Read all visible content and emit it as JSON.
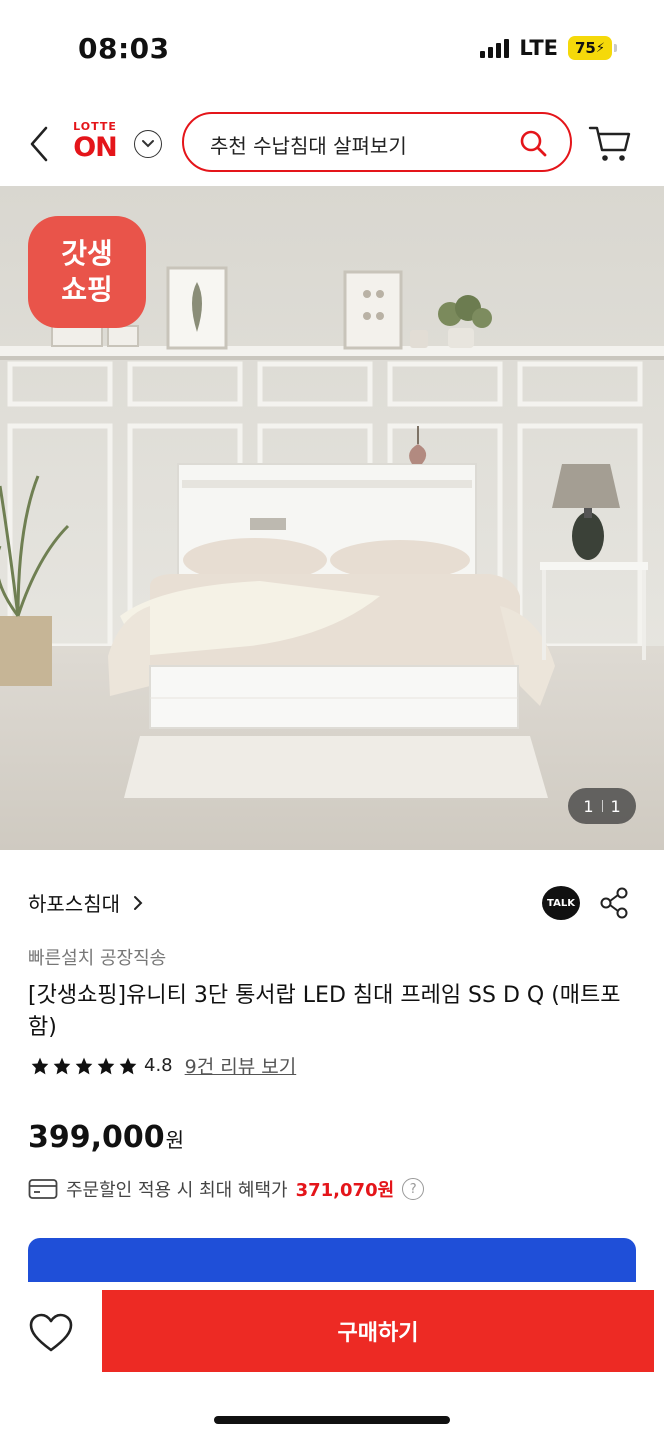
{
  "status": {
    "time": "08:03",
    "network": "LTE",
    "battery": "75"
  },
  "header": {
    "logo_top": "LOTTE",
    "logo_main": "ON",
    "search_text": "추천 수납침대 살펴보기"
  },
  "hero": {
    "badge_line1": "갓생",
    "badge_line2": "쇼핑",
    "page_current": "1",
    "page_total": "1"
  },
  "product": {
    "brand": "하포스침대",
    "talk_label": "TALK",
    "subtitle": "빠른설치 공장직송",
    "title": "[갓생쇼핑]유니티 3단 통서랍 LED 침대 프레임 SS D Q (매트포함)",
    "rating": "4.8",
    "review_link": "9건 리뷰 보기",
    "stars": 5,
    "price": "399,000",
    "price_unit": "원",
    "benefit_label": "주문할인 적용 시 최대 혜택가",
    "benefit_price": "371,070원",
    "help": "?"
  },
  "promo": {
    "text": ""
  },
  "bottom": {
    "buy_label": "구매하기"
  },
  "colors": {
    "brand_red": "#e4151a",
    "buy_red": "#ed2a24",
    "promo_blue": "#1f4fd8",
    "badge_red": "#e9544a"
  }
}
